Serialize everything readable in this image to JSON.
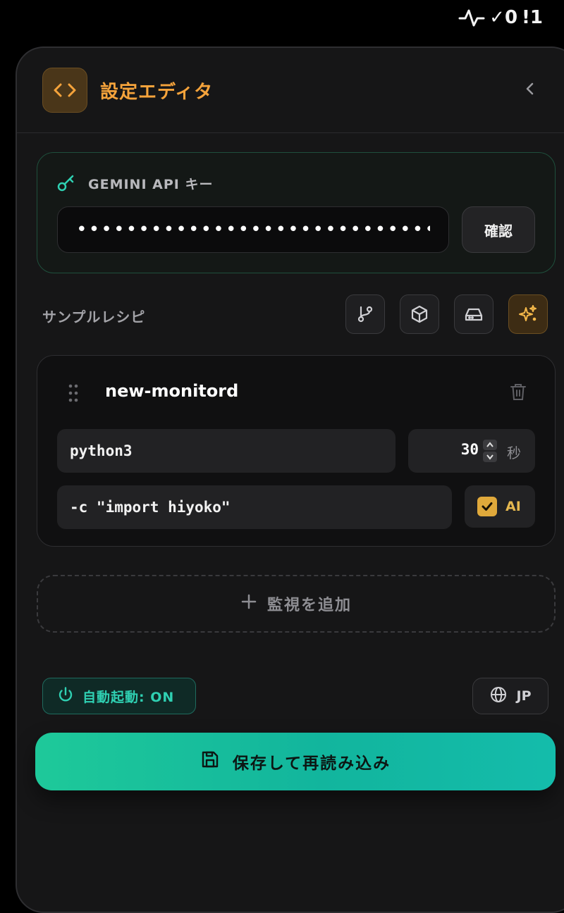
{
  "status_bar": {
    "ok_count": "✓0",
    "warn_count": "!1"
  },
  "header": {
    "title": "設定エディタ"
  },
  "api_key": {
    "label": "GEMINI API キー",
    "value": "•••••••••••••••••••••••••••••••••",
    "confirm_label": "確認"
  },
  "recipes": {
    "label": "サンプルレシピ",
    "buttons": [
      "git-branch-icon",
      "box-icon",
      "drive-icon",
      "sparkles-icon"
    ]
  },
  "monitor": {
    "name": "new-monitord",
    "command": "python3",
    "interval": "30",
    "interval_unit": "秒",
    "args": "-c \"import hiyoko\"",
    "ai_label": "AI",
    "ai_checked": true
  },
  "add_monitor_label": "監視を追加",
  "autostart_label": "自動起動: ON",
  "language_label": "JP",
  "save_label": "保存して再読み込み",
  "colors": {
    "accent_orange": "#f5a33b",
    "accent_teal": "#1ec99a",
    "ai_yellow": "#e0a93b"
  }
}
